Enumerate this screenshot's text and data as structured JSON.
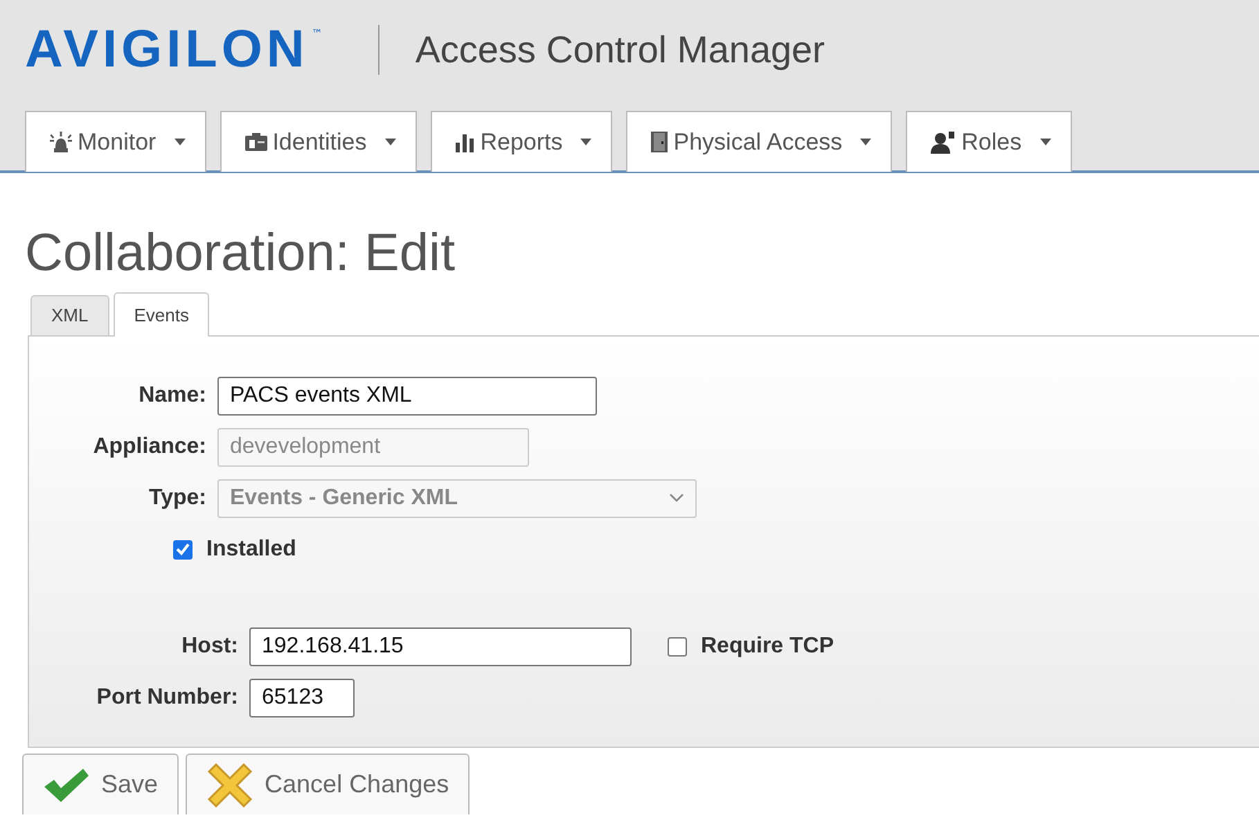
{
  "header": {
    "logo": "AVIGILON",
    "trademark": "™",
    "app_title": "Access Control Manager"
  },
  "nav": [
    {
      "label": "Monitor"
    },
    {
      "label": "Identities"
    },
    {
      "label": "Reports"
    },
    {
      "label": "Physical Access"
    },
    {
      "label": "Roles"
    }
  ],
  "page_title": "Collaboration: Edit",
  "tabs": [
    {
      "label": "XML",
      "selected": false
    },
    {
      "label": "Events",
      "selected": true
    }
  ],
  "form": {
    "name": {
      "label": "Name:",
      "value": "PACS events XML"
    },
    "appliance": {
      "label": "Appliance:",
      "value": "devevelopment",
      "disabled": true
    },
    "type": {
      "label": "Type:",
      "value": "Events - Generic XML",
      "disabled": true
    },
    "installed": {
      "label": "Installed",
      "checked": true
    },
    "host": {
      "label": "Host:",
      "value": "192.168.41.15"
    },
    "require_tcp": {
      "label": "Require TCP",
      "checked": false
    },
    "port": {
      "label": "Port Number:",
      "value": "65123"
    }
  },
  "buttons": [
    {
      "label": "Save",
      "kind": "save"
    },
    {
      "label": "Cancel Changes",
      "kind": "cancel"
    }
  ]
}
